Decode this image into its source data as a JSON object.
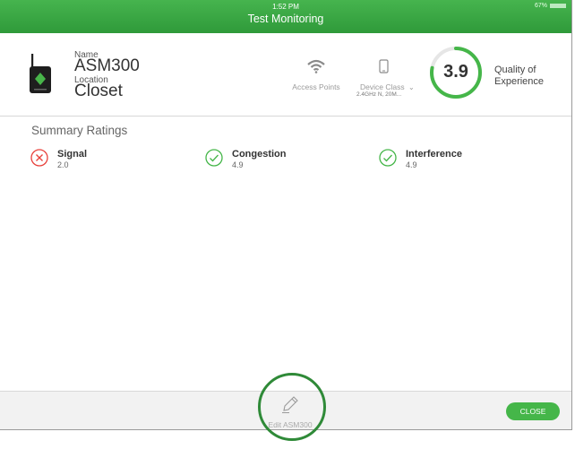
{
  "status_bar": {
    "time": "1:52 PM",
    "battery": "67%"
  },
  "app": {
    "title": "Test Monitoring"
  },
  "device": {
    "name_label": "Name",
    "name": "ASM300",
    "location_label": "Location",
    "location": "Closet"
  },
  "access_points": {
    "label": "Access Points",
    "icon": "wifi-icon"
  },
  "device_class": {
    "label": "Device Class",
    "value": "2.4GHz N, 20M...",
    "icon": "phone-icon"
  },
  "quality": {
    "score": "3.9",
    "label_line1": "Quality of",
    "label_line2": "Experience",
    "fraction": 0.78,
    "color": "#45b649"
  },
  "summary": {
    "title": "Summary Ratings",
    "items": [
      {
        "name": "Signal",
        "value": "2.0",
        "status": "fail",
        "icon": "x-circle-icon",
        "color": "#e8413b"
      },
      {
        "name": "Congestion",
        "value": "4.9",
        "status": "pass",
        "icon": "check-circle-icon",
        "color": "#45b649"
      },
      {
        "name": "Interference",
        "value": "4.9",
        "status": "pass",
        "icon": "check-circle-icon",
        "color": "#45b649"
      }
    ]
  },
  "footer": {
    "edit_label": "Edit ASM300",
    "close_label": "CLOSE"
  }
}
